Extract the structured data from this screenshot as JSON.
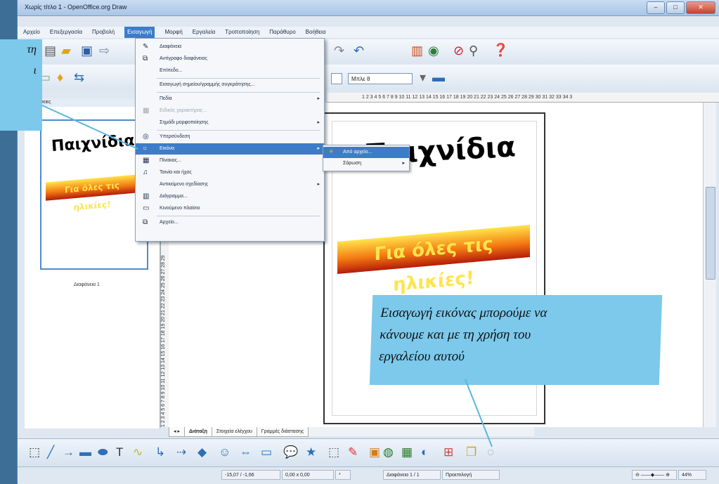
{
  "window": {
    "title": "Χωρίς τίτλο 1 - OpenOffice.org Draw"
  },
  "menubar": [
    "Αρχείο",
    "Επεξεργασία",
    "Προβολή",
    "Εισαγωγή",
    "Μορφή",
    "Εργαλεία",
    "Τροποποίηση",
    "Παράθυρο",
    "Βοήθεια"
  ],
  "insert_menu": {
    "items": [
      {
        "label": "Διαφάνεια",
        "disabled": false,
        "submenu": false
      },
      {
        "label": "Αντίγραφο διαφάνειας",
        "disabled": false,
        "submenu": false
      },
      {
        "label": "Επίπεδο...",
        "disabled": false,
        "submenu": false
      },
      {
        "label": "Εισαγωγή σημείου/γραμμής συγκράτησης...",
        "disabled": false,
        "submenu": false
      },
      {
        "label": "Πεδία",
        "disabled": false,
        "submenu": true
      },
      {
        "label": "Ειδικός χαρακτήρας...",
        "disabled": true,
        "submenu": false
      },
      {
        "label": "Σημάδι μορφοποίησης",
        "disabled": false,
        "submenu": true
      },
      {
        "label": "Υπερσύνδεση",
        "disabled": false,
        "submenu": false
      },
      {
        "label": "Εικόνα",
        "disabled": false,
        "submenu": true
      },
      {
        "label": "Πίνακας...",
        "disabled": false,
        "submenu": false
      },
      {
        "label": "Ταινία και ήχος",
        "disabled": false,
        "submenu": false
      },
      {
        "label": "Αντικείμενο σχεδίασης",
        "disabled": false,
        "submenu": true
      },
      {
        "label": "Διάγραμμα...",
        "disabled": false,
        "submenu": false
      },
      {
        "label": "Κινούμενο πλαίσιο",
        "disabled": false,
        "submenu": false
      },
      {
        "label": "Αρχείο...",
        "disabled": false,
        "submenu": false
      }
    ]
  },
  "image_submenu": [
    "Από αρχείο...",
    "Σάρωση"
  ],
  "toolbar": {
    "color_combo": "Μπλε 8"
  },
  "slides_panel": {
    "header": "Διαφάνειες",
    "thumb_label": "Διαφάνεια 1"
  },
  "slide": {
    "title_text": "Παιχνίδια",
    "subtitle_text": "Για όλες τις ηλικίες!"
  },
  "tabs": [
    "Διάταξη",
    "Στοιχεία ελέγχου",
    "Γραμμές διάστασης"
  ],
  "status": {
    "position": "-15,07 / -1,66",
    "size": "0,00 x 0,00",
    "page": "Διαφάνεια 1 / 1",
    "layout": "Προεπιλογή",
    "zoom": "44%"
  },
  "callouts": {
    "left_lines": [
      "τη",
      "ι"
    ],
    "right_lines": [
      "Εισαγωγή εικόνας μπορούμε να",
      "κάνουμε και με τη χρήση του",
      "εργαλείου αυτού"
    ]
  },
  "ruler_numbers": "1 2 3 4 5 6 7 8 9 10 11 12 13 14 15 16 17 18 19 20 21 22 23 24 25 26 27 28 29 30 31 32 33 34 3",
  "vruler_numbers": "1 2 3 4 5 6 7 8 9 10 11 12 13 14 15 16 17 18 19 20 21 22 23 24 25 26 27 28 29",
  "colors": {
    "callout": "#7cc9ec",
    "menu_highlight": "#3d7cc9"
  }
}
